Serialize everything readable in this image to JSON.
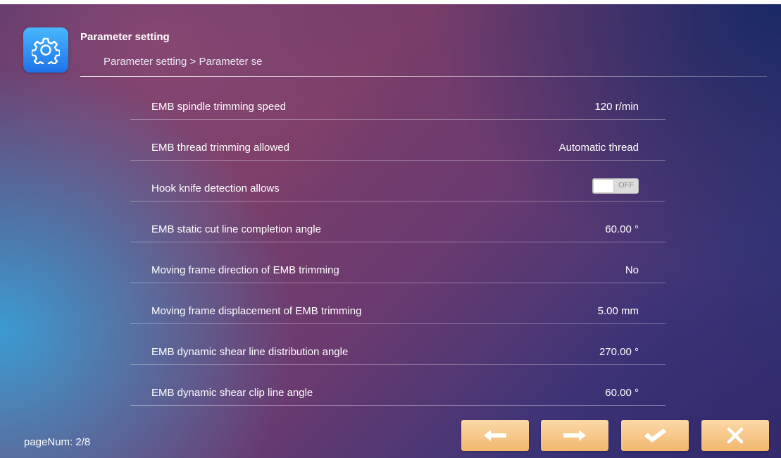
{
  "header": {
    "title": "Parameter setting",
    "breadcrumb": "Parameter setting > Parameter se",
    "icon": "gear-icon"
  },
  "params": [
    {
      "label": "EMB spindle trimming speed",
      "value": "120 r/min"
    },
    {
      "label": "EMB thread trimming allowed",
      "value": "Automatic thread"
    },
    {
      "label": "Hook knife detection allows",
      "toggle_text": "OFF",
      "toggle_on": false
    },
    {
      "label": "EMB static cut line completion angle",
      "value": "60.00 °"
    },
    {
      "label": "Moving frame direction of EMB trimming",
      "value": "No"
    },
    {
      "label": "Moving frame displacement of EMB trimming",
      "value": "5.00 mm"
    },
    {
      "label": "EMB dynamic shear line distribution angle",
      "value": "270.00 °"
    },
    {
      "label": "EMB dynamic shear clip line angle",
      "value": "60.00 °"
    }
  ],
  "footer": {
    "page_num": "pageNum: 2/8",
    "buttons": [
      "arrow-left-icon",
      "arrow-right-icon",
      "check-icon",
      "close-icon"
    ]
  },
  "colors": {
    "button_bg": "#f2b76e",
    "icon_bg": "#1e72e8"
  }
}
